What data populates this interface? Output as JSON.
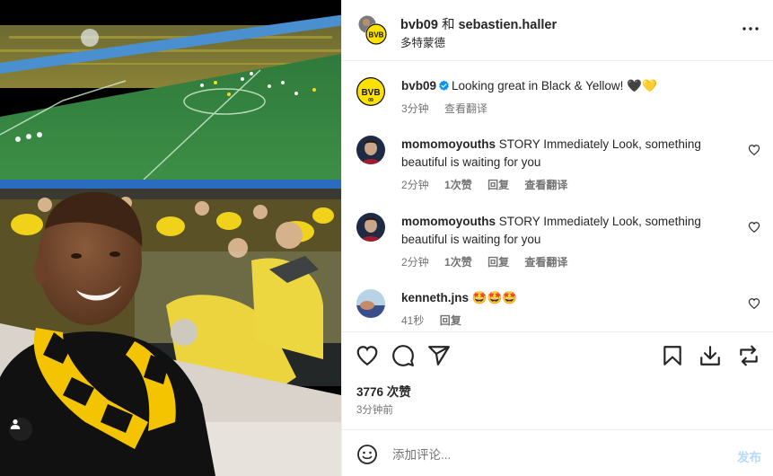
{
  "header": {
    "account1": "bvb09",
    "conjunction": "和",
    "account2": "sebastien.haller",
    "location": "多特蒙德"
  },
  "caption": {
    "username": "bvb09",
    "text": "Looking great in Black & Yellow! 🖤💛",
    "time": "3分钟",
    "translate": "查看翻译"
  },
  "comments": [
    {
      "username": "momomoyouths",
      "text": "STORY Immediately Look, something beautiful is waiting for you",
      "time": "2分钟",
      "likes": "1次赞",
      "reply": "回复",
      "translate": "查看翻译"
    },
    {
      "username": "momomoyouths",
      "text": "STORY Immediately Look, something beautiful is waiting for you",
      "time": "2分钟",
      "likes": "1次赞",
      "reply": "回复",
      "translate": "查看翻译"
    },
    {
      "username": "kenneth.jns",
      "text": "🤩🤩🤩",
      "time": "41秒",
      "reply": "回复"
    }
  ],
  "post": {
    "likes": "3776 次赞",
    "time": "3分钟前"
  },
  "composer": {
    "placeholder": "添加评论...",
    "post_label": "发布"
  },
  "colors": {
    "bvb_yellow": "#fde100",
    "verified_blue": "#0095f6",
    "post_button_disabled": "#b3dbff",
    "secondary_text": "#737373"
  },
  "icons": [
    "user-tag-icon",
    "more-options-icon",
    "verified-badge-icon",
    "heart-icon",
    "comment-icon",
    "share-icon",
    "bookmark-icon",
    "download-icon",
    "repost-icon",
    "emoji-icon"
  ]
}
